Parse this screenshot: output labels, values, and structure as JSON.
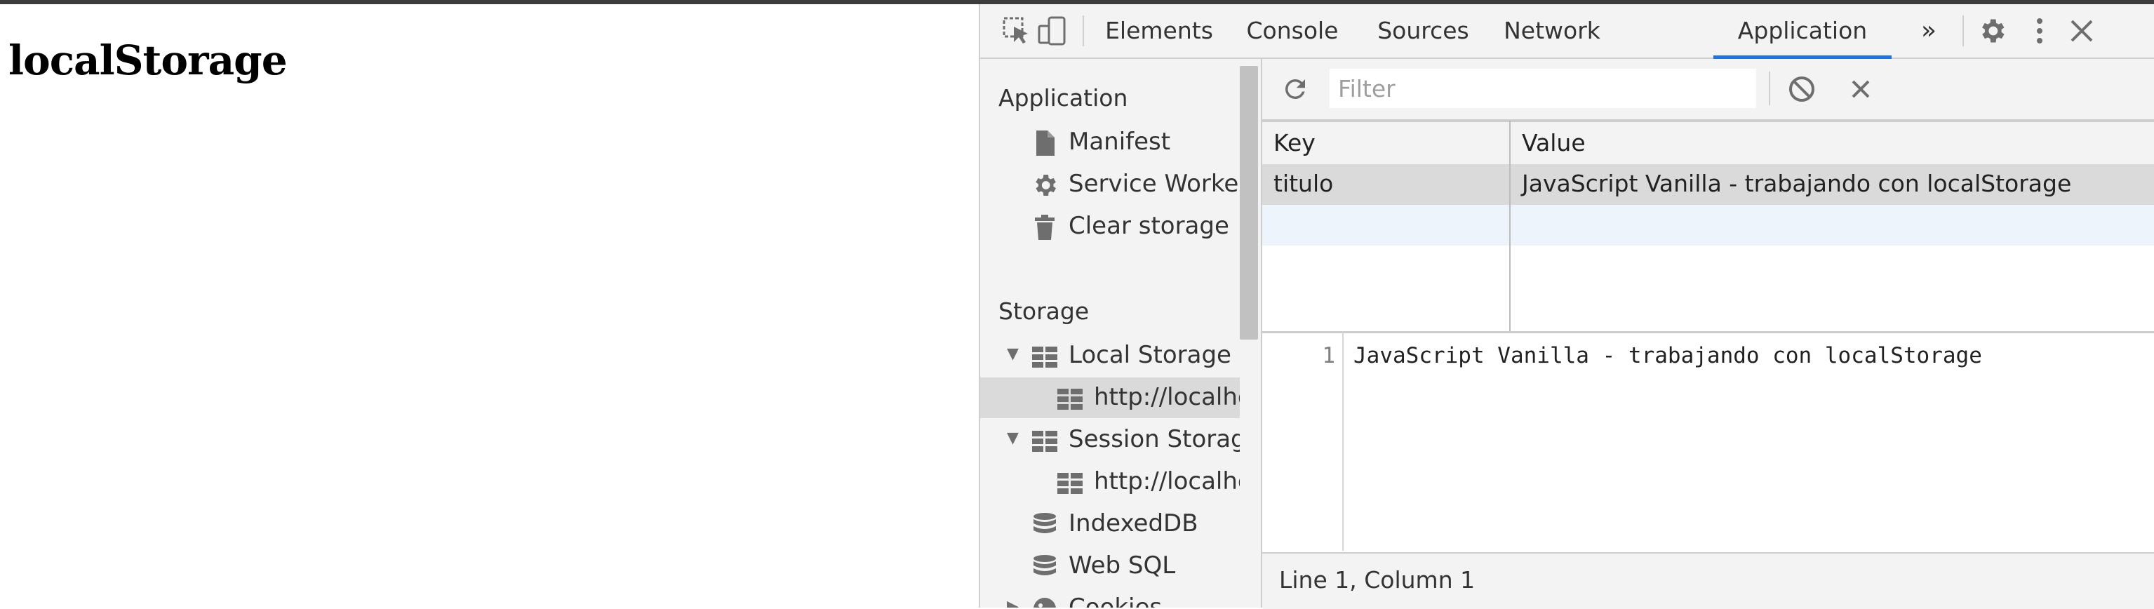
{
  "page": {
    "heading": "localStorage"
  },
  "devtools": {
    "tabs": [
      "Elements",
      "Console",
      "Sources",
      "Network",
      "Application"
    ],
    "active_tab": "Application",
    "more_tabs_glyph": "»",
    "icons": [
      "inspect-element-icon",
      "device-toolbar-icon",
      "settings-gear-icon",
      "kebab-menu-icon",
      "close-icon"
    ],
    "accent_color": "#1a73e8"
  },
  "sidebar": {
    "application_header": "Application",
    "application_items": [
      {
        "label": "Manifest",
        "icon": "file-icon"
      },
      {
        "label": "Service Workers",
        "icon": "gear-icon"
      },
      {
        "label": "Clear storage",
        "icon": "trash-icon"
      }
    ],
    "storage_header": "Storage",
    "storage_items": [
      {
        "label": "Local Storage",
        "icon": "grid-table-icon",
        "expanded": true
      },
      {
        "label": "http://localhost",
        "icon": "grid-table-icon",
        "selected": true
      },
      {
        "label": "Session Storage",
        "icon": "grid-table-icon",
        "expanded": true
      },
      {
        "label": "http://localhost",
        "icon": "grid-table-icon"
      },
      {
        "label": "IndexedDB",
        "icon": "database-icon"
      },
      {
        "label": "Web SQL",
        "icon": "database-icon"
      },
      {
        "label": "Cookies",
        "icon": "cookie-icon"
      }
    ]
  },
  "toolbar": {
    "filter_placeholder": "Filter",
    "icons": [
      "refresh-icon",
      "clear-all-icon",
      "delete-selected-icon"
    ]
  },
  "table": {
    "columns": [
      "Key",
      "Value"
    ],
    "rows": [
      {
        "key": "titulo",
        "value": "JavaScript Vanilla - trabajando con localStorage"
      }
    ]
  },
  "preview": {
    "line_number": "1",
    "content": "JavaScript Vanilla - trabajando con localStorage"
  },
  "status": {
    "text": "Line 1, Column 1"
  }
}
